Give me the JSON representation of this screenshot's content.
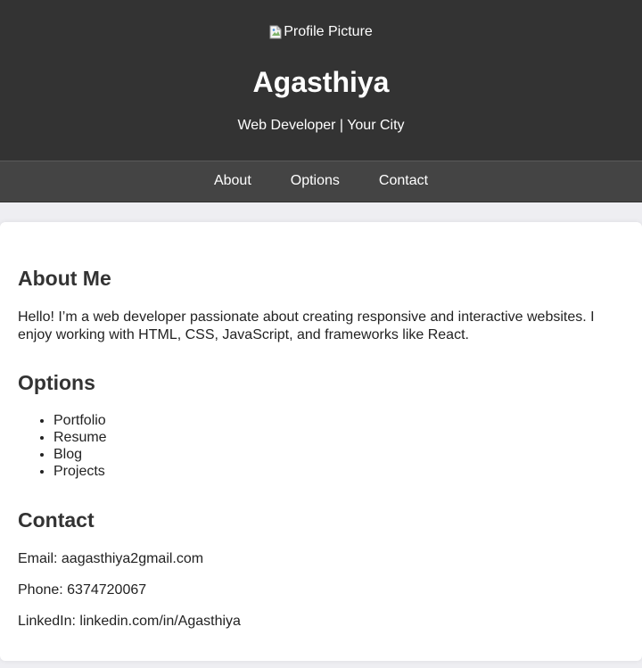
{
  "header": {
    "profile_alt": "Profile Picture",
    "name": "Agasthiya",
    "tagline": "Web Developer | Your City",
    "colors": {
      "header_bg": "#333333",
      "nav_bg": "#444444"
    }
  },
  "nav": {
    "items": [
      {
        "label": "About"
      },
      {
        "label": "Options"
      },
      {
        "label": "Contact"
      }
    ]
  },
  "about": {
    "title": "About Me",
    "text": "Hello! I’m a web developer passionate about creating responsive and interactive websites. I enjoy working with HTML, CSS, JavaScript, and frameworks like React."
  },
  "options": {
    "title": "Options",
    "items": [
      "Portfolio",
      "Resume",
      "Blog",
      "Projects"
    ]
  },
  "contact": {
    "title": "Contact",
    "email": "Email: aagasthiya2gmail.com",
    "phone": "Phone: 6374720067",
    "linkedin": "LinkedIn: linkedin.com/in/Agasthiya"
  },
  "icons": {
    "broken_image": "broken-image-icon"
  }
}
